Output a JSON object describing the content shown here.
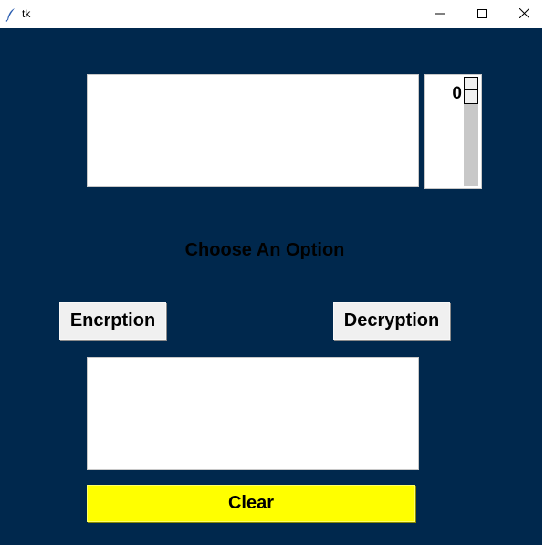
{
  "window": {
    "title": "tk",
    "icon": "feather-icon",
    "controls": [
      "minimize-icon",
      "maximize-icon",
      "close-icon"
    ]
  },
  "colors": {
    "background": "#00284d",
    "clear_button": "#ffff00",
    "button": "#f0f0f0",
    "text": "#000000"
  },
  "input_box": {
    "value": ""
  },
  "spinner": {
    "value": "0",
    "position": 0
  },
  "option_label": "Choose An Option",
  "buttons": {
    "encrypt_label": "Encrption",
    "decrypt_label": "Decryption",
    "clear_label": "Clear"
  },
  "output_box": {
    "value": ""
  }
}
